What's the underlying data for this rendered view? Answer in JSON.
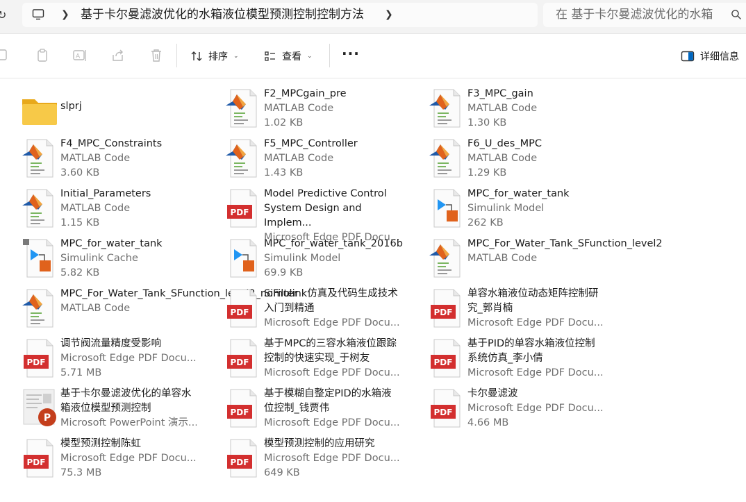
{
  "addressbar": {
    "breadcrumb": "基于卡尔曼滤波优化的水箱液位模型预测控制控制方法",
    "search_placeholder": "在 基于卡尔曼滤波优化的水箱"
  },
  "toolbar": {
    "sort_label": "排序",
    "view_label": "查看",
    "more_label": "···",
    "details_label": "详细信息"
  },
  "files": [
    {
      "name": "slprj",
      "meta": [],
      "icon": "folder-icon"
    },
    {
      "name": "F2_MPCgain_pre",
      "meta": [
        "MATLAB Code",
        "1.02 KB"
      ],
      "icon": "matlab-file-icon"
    },
    {
      "name": "F3_MPC_gain",
      "meta": [
        "MATLAB Code",
        "1.30 KB"
      ],
      "icon": "matlab-file-icon"
    },
    {
      "name": "F4_MPC_Constraints",
      "meta": [
        "MATLAB Code",
        "3.60 KB"
      ],
      "icon": "matlab-file-icon"
    },
    {
      "name": "F5_MPC_Controller",
      "meta": [
        "MATLAB Code",
        "1.43 KB"
      ],
      "icon": "matlab-file-icon"
    },
    {
      "name": "F6_U_des_MPC",
      "meta": [
        "MATLAB Code",
        "1.29 KB"
      ],
      "icon": "matlab-file-icon"
    },
    {
      "name": "Initial_Parameters",
      "meta": [
        "MATLAB Code",
        "1.15 KB"
      ],
      "icon": "matlab-file-icon"
    },
    {
      "name": "Model Predictive Control System Design and Implem...",
      "meta": [
        "Microsoft Edge PDF Docu..."
      ],
      "icon": "pdf-file-icon"
    },
    {
      "name": "MPC_for_water_tank",
      "meta": [
        "Simulink Model",
        "262 KB"
      ],
      "icon": "simulink-model-icon"
    },
    {
      "name": "MPC_for_water_tank",
      "meta": [
        "Simulink Cache",
        "5.82 KB"
      ],
      "icon": "simulink-cache-icon"
    },
    {
      "name": "MPC_for_water_tank_2016b",
      "meta": [
        "Simulink Model",
        "69.9 KB"
      ],
      "icon": "simulink-model-icon"
    },
    {
      "name": "MPC_For_Water_Tank_SFunction_level2",
      "meta": [
        "MATLAB Code"
      ],
      "icon": "matlab-file-icon"
    },
    {
      "name": "MPC_For_Water_Tank_SFunction_level2_noFilter",
      "meta": [
        "MATLAB Code"
      ],
      "icon": "matlab-file-icon"
    },
    {
      "name": "Simulink仿真及代码生成技术入门到精通",
      "meta": [
        "Microsoft Edge PDF Docu..."
      ],
      "icon": "pdf-file-icon"
    },
    {
      "name": "单容水箱液位动态矩阵控制研究_郭肖楠",
      "meta": [
        "Microsoft Edge PDF Docu..."
      ],
      "icon": "pdf-file-icon"
    },
    {
      "name": "调节阀流量精度受影响",
      "meta": [
        "Microsoft Edge PDF Docu...",
        "5.71 MB"
      ],
      "icon": "pdf-file-icon"
    },
    {
      "name": "基于MPC的三容水箱液位跟踪控制的快速实现_于树友",
      "meta": [
        "Microsoft Edge PDF Docu..."
      ],
      "icon": "pdf-file-icon"
    },
    {
      "name": "基于PID的单容水箱液位控制系统仿真_李小倩",
      "meta": [
        "Microsoft Edge PDF Docu..."
      ],
      "icon": "pdf-file-icon"
    },
    {
      "name": "基于卡尔曼滤波优化的单容水箱液位模型预测控制",
      "meta": [
        "Microsoft PowerPoint 演示..."
      ],
      "icon": "powerpoint-file-icon"
    },
    {
      "name": "基于模糊自整定PID的水箱液位控制_钱贾伟",
      "meta": [
        "Microsoft Edge PDF Docu..."
      ],
      "icon": "pdf-file-icon"
    },
    {
      "name": "卡尔曼滤波",
      "meta": [
        "Microsoft Edge PDF Docu...",
        "4.66 MB"
      ],
      "icon": "pdf-file-icon"
    },
    {
      "name": "模型预测控制陈虹",
      "meta": [
        "Microsoft Edge PDF Docu...",
        "75.3 MB"
      ],
      "icon": "pdf-file-icon"
    },
    {
      "name": "模型预测控制的应用研究",
      "meta": [
        "Microsoft Edge PDF Docu...",
        "649 KB"
      ],
      "icon": "pdf-file-icon"
    }
  ],
  "colors": {
    "accent": "#0067c0",
    "pdf_red": "#d32f2f",
    "folder": "#f7c948",
    "matlab_orange": "#e0621c"
  }
}
